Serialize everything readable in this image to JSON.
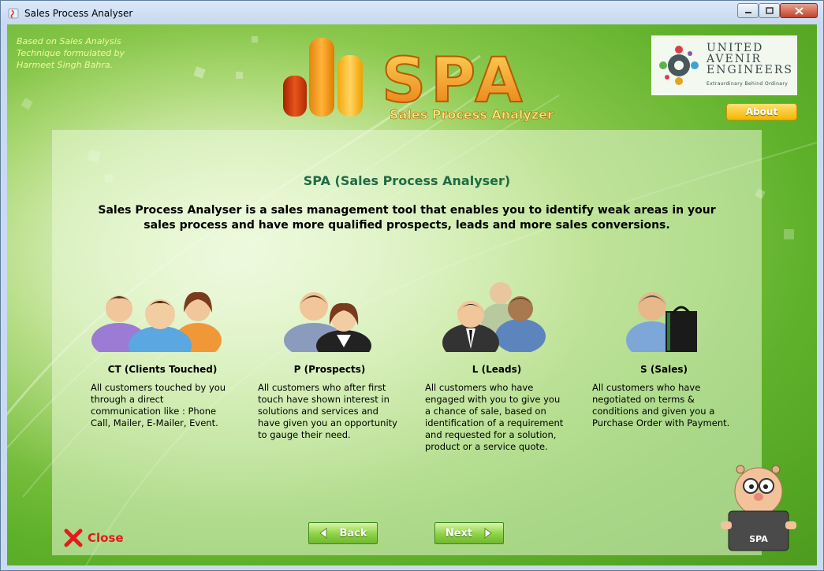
{
  "window": {
    "title": "Sales Process Analyser"
  },
  "credit": [
    "Based on Sales Analysis",
    "Technique formulated by",
    "Harmeet Singh Bahra."
  ],
  "logo": {
    "letters": "SPA",
    "subtitle": "Sales Process Analyzer"
  },
  "company": {
    "line1": "United",
    "line2": "Avenir",
    "line3": "Engineers",
    "tagline": "Extraordinary Behind Ordinary"
  },
  "about_label": "About",
  "panel": {
    "title": "SPA (Sales Process Analyser)",
    "intro": "Sales Process Analyser is a sales management tool that enables you to identify weak areas in your sales process and have more qualified prospects, leads and more sales conversions."
  },
  "cards": [
    {
      "label": "CT (Clients Touched)",
      "desc": "All customers touched by you through a direct communication like : Phone Call, Mailer, E-Mailer, Event."
    },
    {
      "label": "P (Prospects)",
      "desc": "All customers who after first touch have shown interest in solutions and services and have given you an opportunity to gauge their need."
    },
    {
      "label": "L (Leads)",
      "desc": "All customers who have engaged with you to give you a chance of sale, based on identification of a requirement and requested for a solution, product or a service quote."
    },
    {
      "label": "S (Sales)",
      "desc": "All customers who have negotiated on terms & conditions and given you a Purchase Order with Payment."
    }
  ],
  "buttons": {
    "close": "Close",
    "back": "Back",
    "next": "Next"
  },
  "mascot_label": "SPA",
  "colors": {
    "title_green": "#1e6b46",
    "close_red": "#e21c1c",
    "about_gold": "#f3b600"
  },
  "icons": [
    "app-icon",
    "minimize-icon",
    "maximize-icon",
    "window-close-icon",
    "company-logo-icon",
    "clients-group-icon",
    "prospects-icon",
    "leads-icon",
    "sales-icon",
    "close-x-icon",
    "back-arrow-icon",
    "next-arrow-icon",
    "mascot-icon"
  ]
}
